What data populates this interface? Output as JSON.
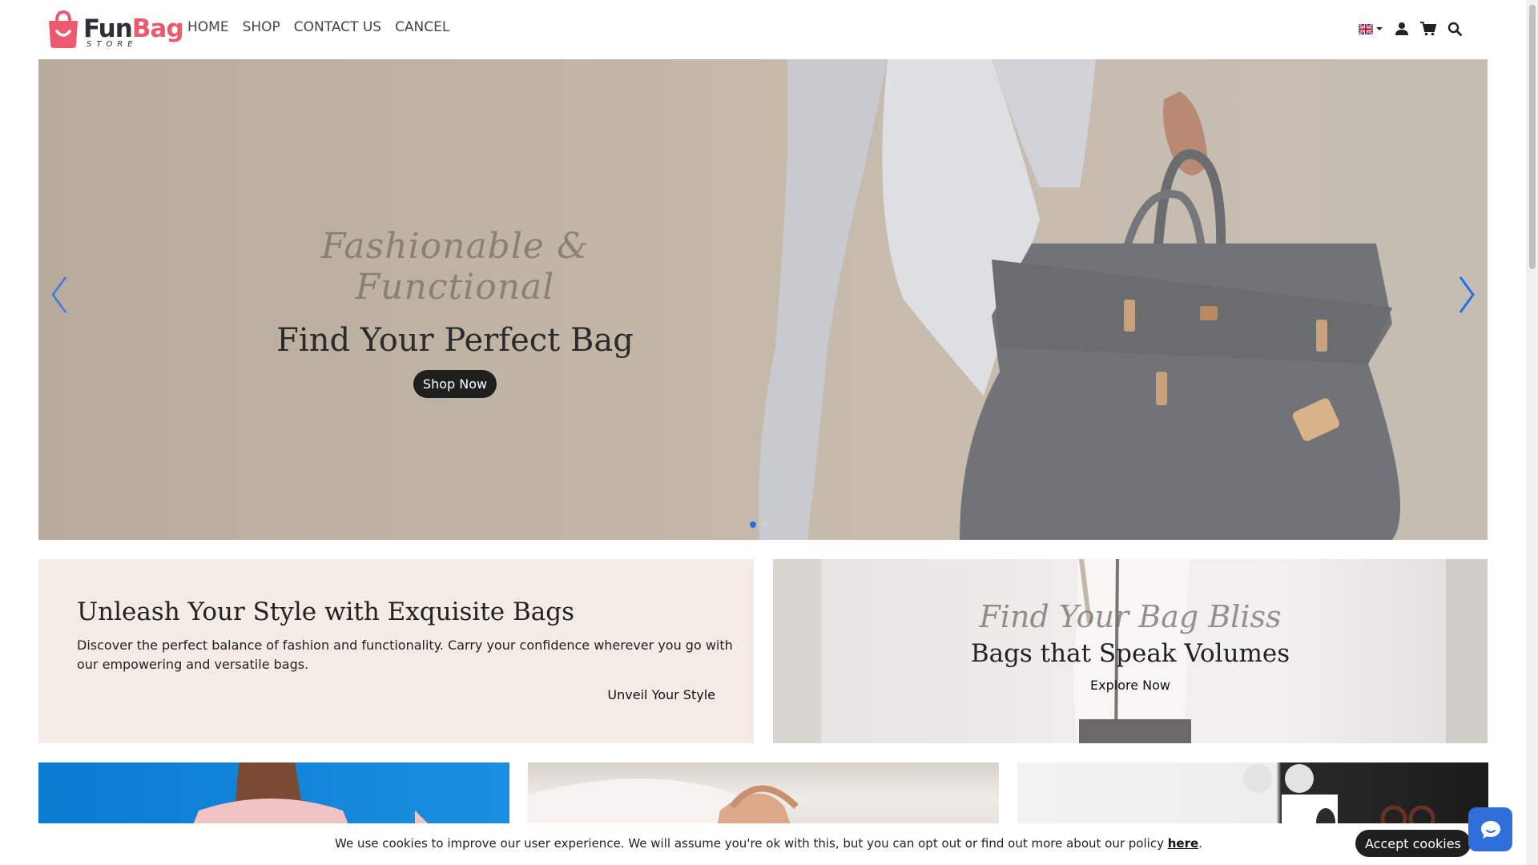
{
  "brand": {
    "name_part1": "Fun",
    "name_part2": "Bag",
    "sub": "STORE",
    "color": "#ec5a6f"
  },
  "nav": {
    "items": [
      {
        "label": "HOME"
      },
      {
        "label": "SHOP"
      },
      {
        "label": "CONTACT US"
      },
      {
        "label": "CANCEL"
      }
    ]
  },
  "header_tools": {
    "icons": [
      "uk-flag-icon",
      "user-icon",
      "cart-icon",
      "search-icon"
    ]
  },
  "hero": {
    "script": "Fashionable & Functional",
    "title": "Find Your Perfect Bag",
    "button": "Shop Now",
    "slide_count": 2,
    "active_slide": 1,
    "accent": "#1e73e8"
  },
  "promo_left": {
    "title": "Unleash Your Style with Exquisite Bags",
    "description": "Discover the perfect balance of fashion and functionality. Carry your confidence wherever you go with our empowering and versatile bags.",
    "link": "Unveil Your Style"
  },
  "promo_right": {
    "script": "Find Your Bag Bliss",
    "title": "Bags that Speak Volumes",
    "link": "Explore Now"
  },
  "cookie": {
    "text": "We use cookies to improve our user experience. We will assume you're ok with this, but you can opt out or find out more about our policy ",
    "link": "here",
    "suffix": ".",
    "button": "Accept cookies"
  }
}
